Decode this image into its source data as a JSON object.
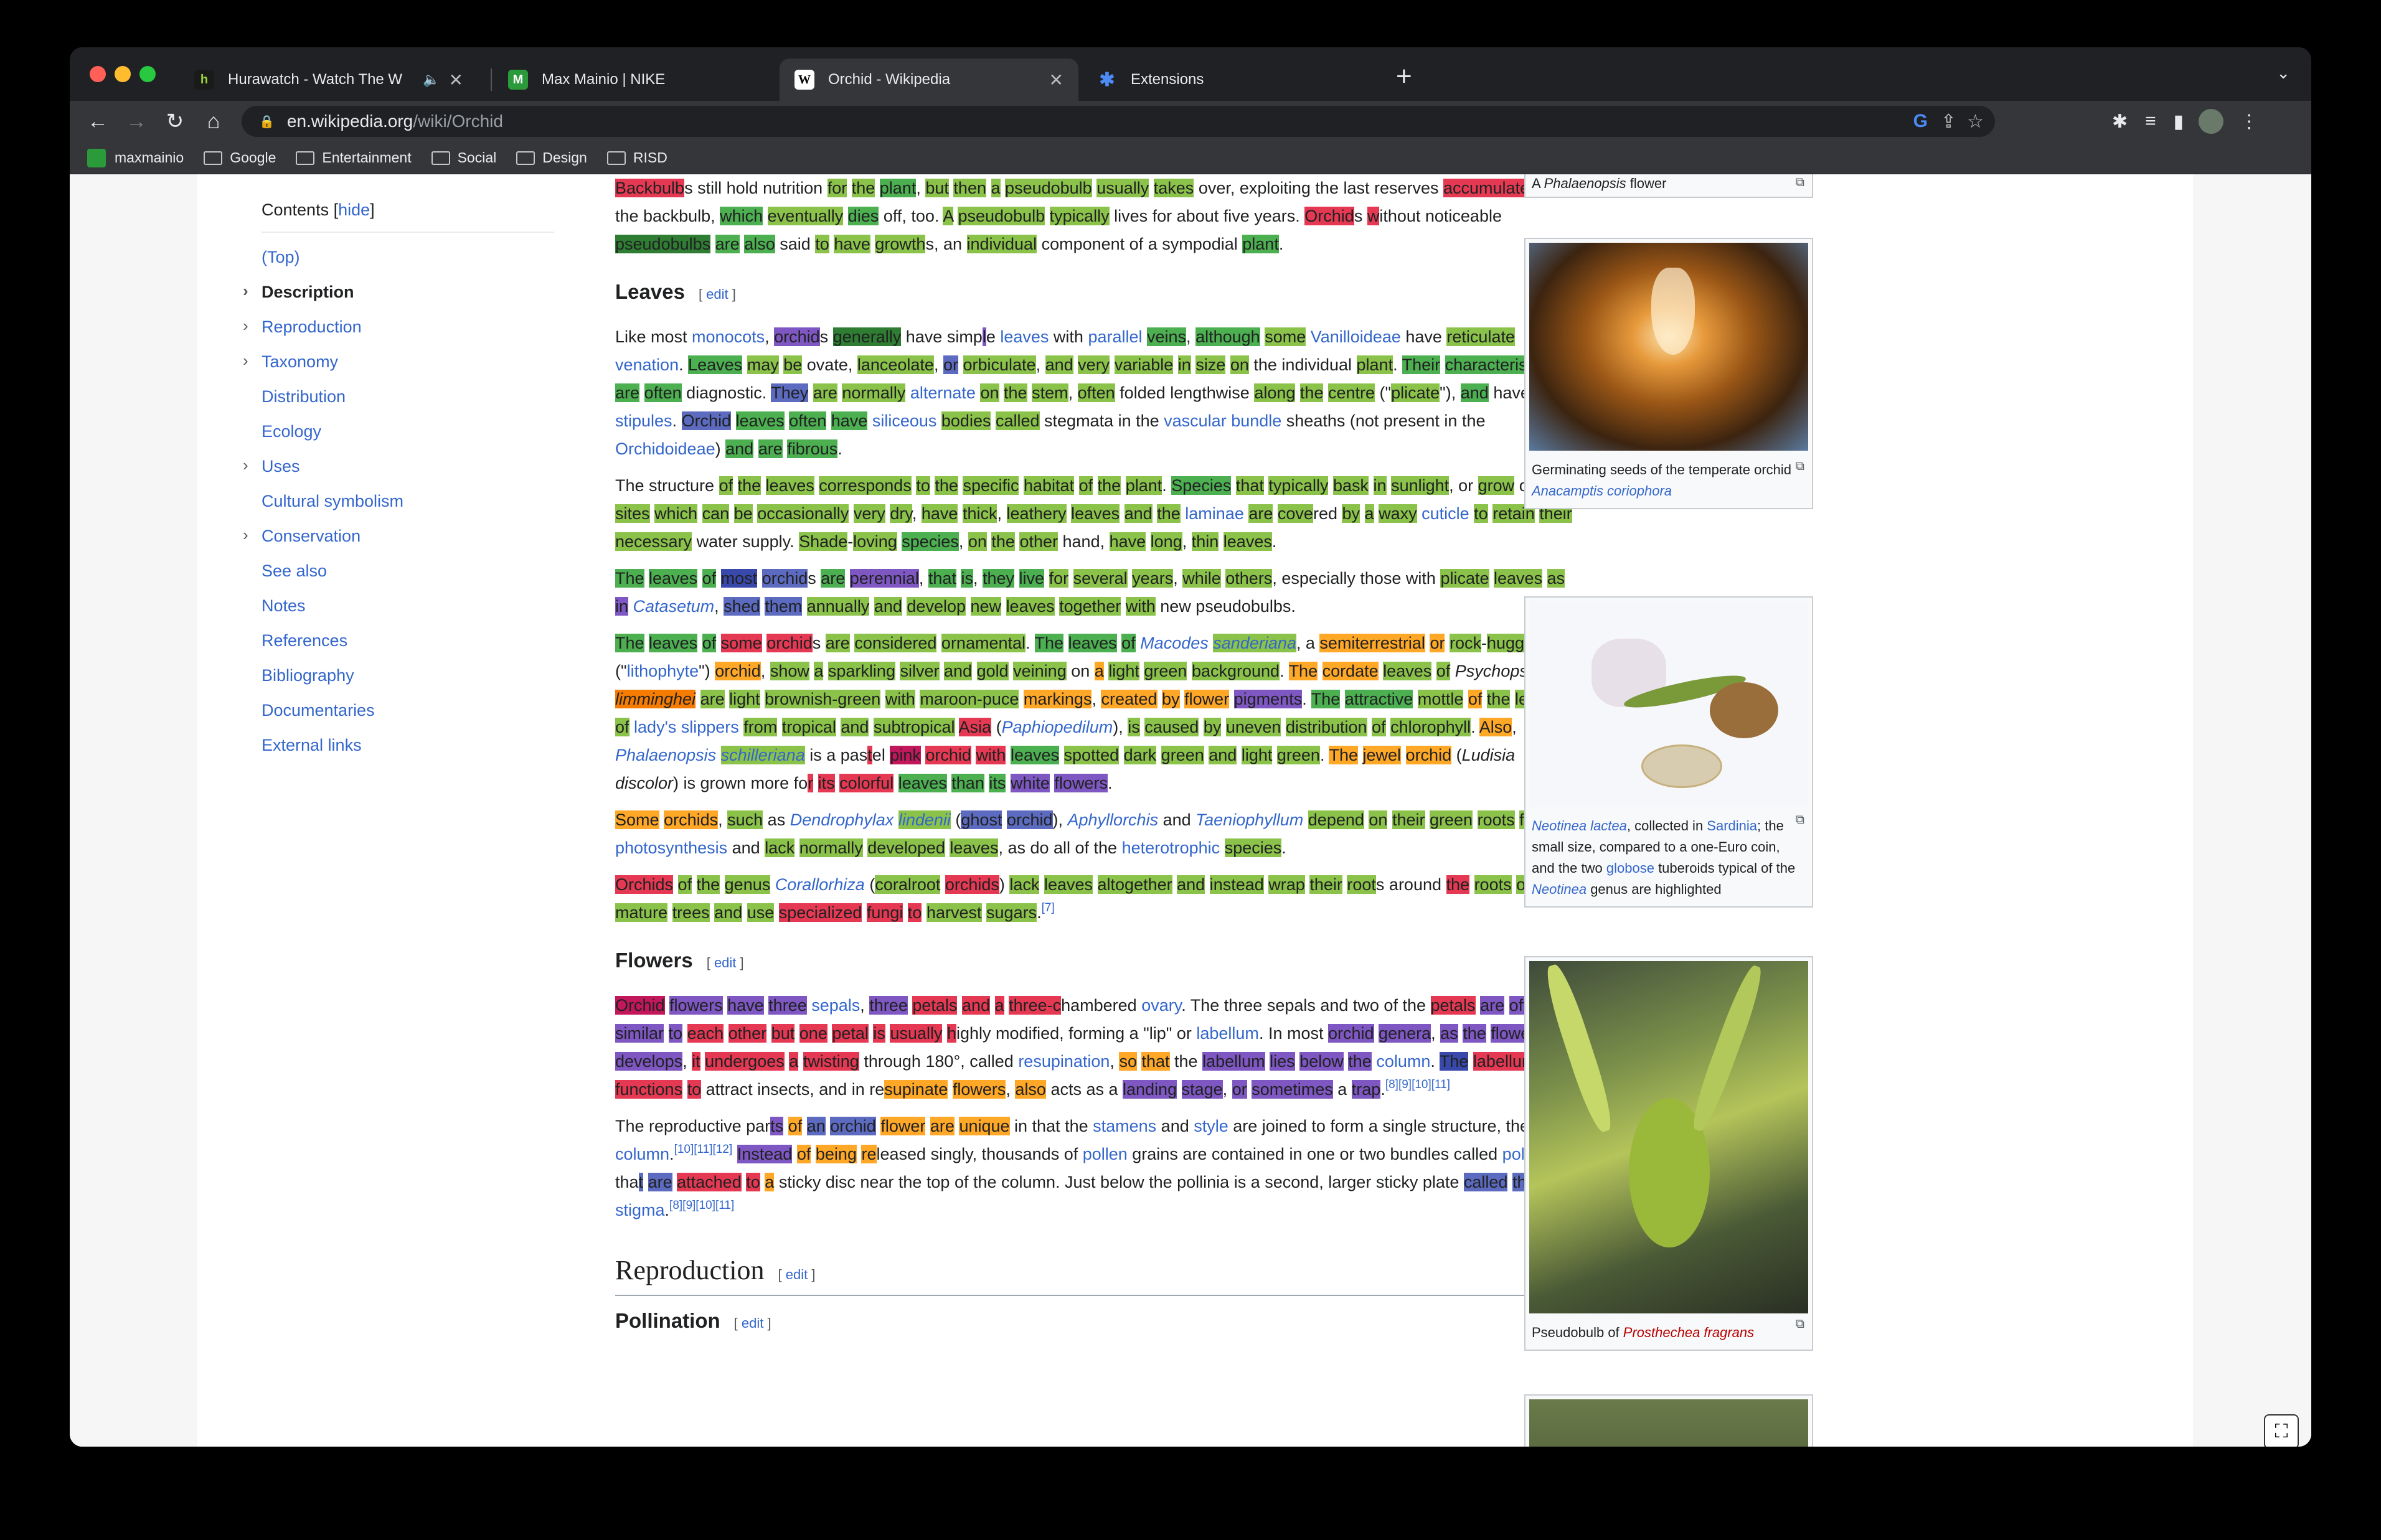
{
  "tabs": [
    {
      "title": "Hurawatch - Watch The W",
      "icon": "hurawatch-icon",
      "audio": true
    },
    {
      "title": "Max Mainio | NIKE",
      "icon": "nike-profile-icon"
    },
    {
      "title": "Orchid - Wikipedia",
      "icon": "wikipedia-icon",
      "active": true
    },
    {
      "title": "Extensions",
      "icon": "extensions-puzzle-icon"
    }
  ],
  "omnibox": {
    "host": "en.wikipedia.org",
    "path": "/wiki/Orchid"
  },
  "bookmarks": [
    "maxmainio",
    "Google",
    "Entertainment",
    "Social",
    "Design",
    "RISD"
  ],
  "toc": {
    "title": "Contents",
    "hide": "hide",
    "items": [
      {
        "label": "(Top)",
        "chevron": false
      },
      {
        "label": "Description",
        "chevron": true,
        "bold": true
      },
      {
        "label": "Reproduction",
        "chevron": true
      },
      {
        "label": "Taxonomy",
        "chevron": true
      },
      {
        "label": "Distribution",
        "chevron": false
      },
      {
        "label": "Ecology",
        "chevron": false
      },
      {
        "label": "Uses",
        "chevron": true
      },
      {
        "label": "Cultural symbolism",
        "chevron": false
      },
      {
        "label": "Conservation",
        "chevron": true
      },
      {
        "label": "See also",
        "chevron": false
      },
      {
        "label": "Notes",
        "chevron": false
      },
      {
        "label": "References",
        "chevron": false
      },
      {
        "label": "Bibliography",
        "chevron": false
      },
      {
        "label": "Documentaries",
        "chevron": false
      },
      {
        "label": "External links",
        "chevron": false
      }
    ]
  },
  "headings": {
    "leaves": "Leaves",
    "flowers": "Flowers",
    "reproduction": "Reproduction",
    "pollination": "Pollination",
    "edit": "edit"
  },
  "figures": [
    {
      "caption_pre": "A ",
      "caption_italic": "Phalaenopsis",
      "caption_post": " flower"
    },
    {
      "caption_pre": "Germinating seeds of the temperate orchid ",
      "caption_link": "Anacamptis coriophora"
    },
    {
      "caption_link1": "Neotinea lactea",
      "caption_mid1": ", collected in ",
      "caption_link2": "Sardinia",
      "caption_mid2": "; the small size, compared to a one-Euro coin, and the two ",
      "caption_link3": "globose",
      "caption_mid3": " tuberoids typical of the ",
      "caption_link4": "Neotinea",
      "caption_post": " genus are highlighted"
    },
    {
      "caption_pre": "Pseudobulb of ",
      "caption_link": "Prosthechea fragrans"
    }
  ],
  "colors": {
    "link": "#3366cc",
    "chrome_bg": "#202124",
    "toolbar_bg": "#35363a"
  }
}
